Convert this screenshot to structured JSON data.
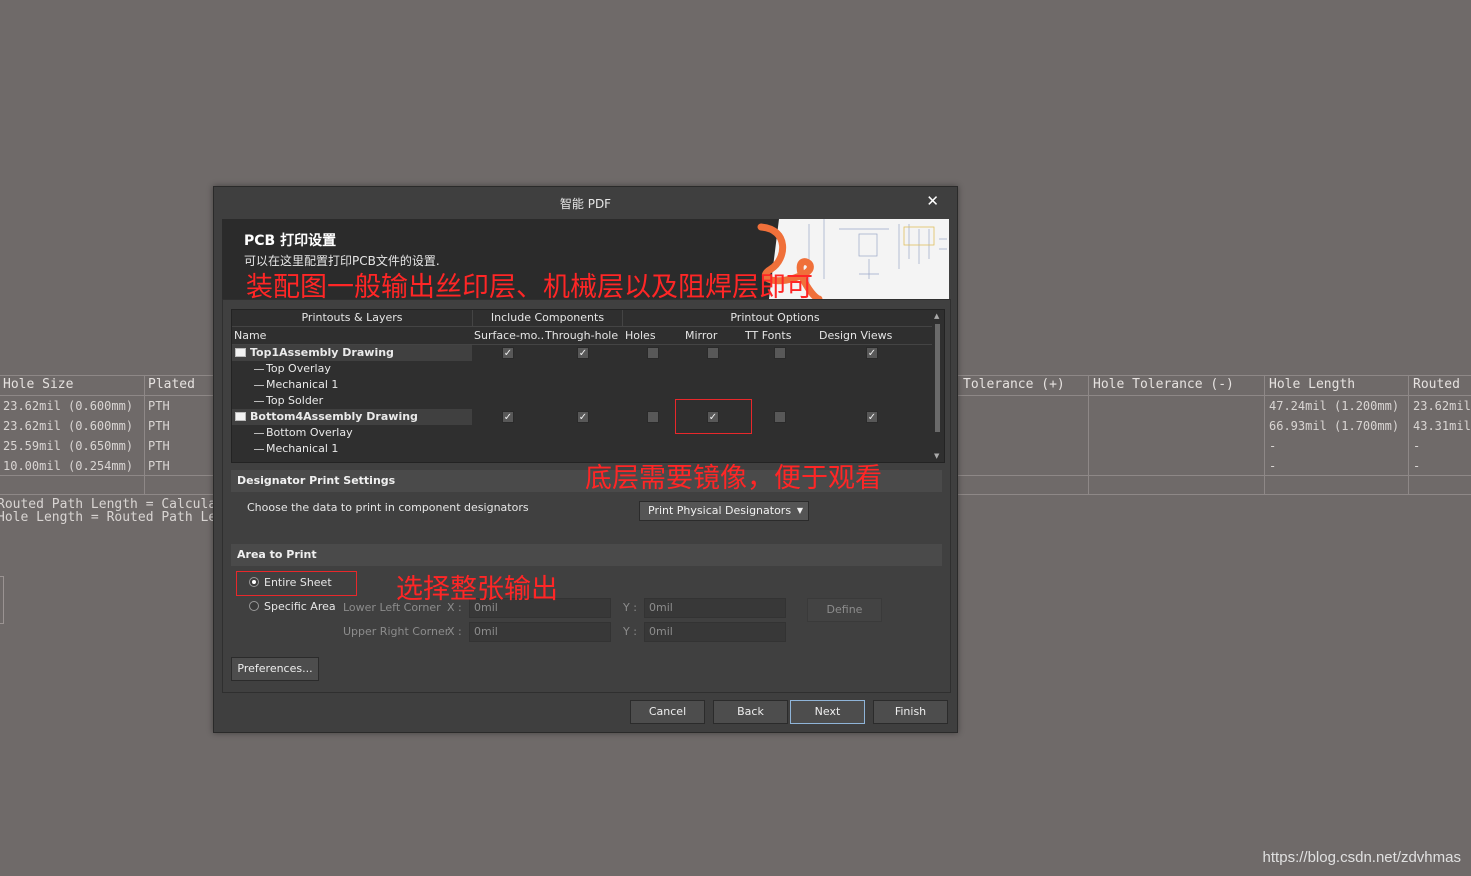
{
  "background_table": {
    "headers": [
      "Hole Size",
      "Plated",
      "Tolerance (+)",
      "Hole Tolerance (-)",
      "Hole Length",
      "Routed"
    ],
    "rows": [
      {
        "hole_size": "23.62mil (0.600mm)",
        "plated": "PTH",
        "hole_length": "47.24mil (1.200mm)",
        "routed": "23.62mil"
      },
      {
        "hole_size": "23.62mil (0.600mm)",
        "plated": "PTH",
        "hole_length": "66.93mil (1.700mm)",
        "routed": "43.31mil"
      },
      {
        "hole_size": "25.59mil (0.650mm)",
        "plated": "PTH",
        "hole_length": "-",
        "routed": "-"
      },
      {
        "hole_size": "10.00mil (0.254mm)",
        "plated": "PTH",
        "hole_length": "-",
        "routed": "-"
      }
    ],
    "notes": [
      "Routed Path Length = Calculat",
      "Hole Length  = Routed Path Le"
    ]
  },
  "watermark": "https://blog.csdn.net/zdvhmas",
  "dialog": {
    "title": "智能 PDF",
    "close_glyph": "✕",
    "banner": {
      "title": "PCB 打印设置",
      "subtitle": "可以在这里配置打印PCB文件的设置."
    },
    "table": {
      "group_headers": {
        "printouts": "Printouts & Layers",
        "include": "Include Components",
        "options": "Printout Options"
      },
      "columns": {
        "name": "Name",
        "surface": "Surface-mo...",
        "through": "Through-hole",
        "holes": "Holes",
        "mirror": "Mirror",
        "ttfonts": "TT Fonts",
        "design": "Design Views"
      },
      "printouts": [
        {
          "name": "Top1Assembly Drawing",
          "surface": true,
          "through": true,
          "holes": false,
          "mirror": false,
          "ttfonts": false,
          "design": true,
          "layers": [
            "Top Overlay",
            "Mechanical 1",
            "Top Solder"
          ]
        },
        {
          "name": "Bottom4Assembly Drawing",
          "surface": true,
          "through": true,
          "holes": false,
          "mirror": true,
          "ttfonts": false,
          "design": true,
          "layers": [
            "Bottom Overlay",
            "Mechanical 1"
          ]
        }
      ]
    },
    "designator": {
      "section": "Designator Print Settings",
      "label": "Choose the data to print in component designators",
      "dropdown": "Print Physical Designators"
    },
    "area": {
      "section": "Area to Print",
      "entire_sheet": "Entire Sheet",
      "specific_area": "Specific Area",
      "selected": "entire_sheet",
      "lower_left": "Lower Left Corner",
      "upper_right": "Upper Right Corner",
      "x_label": "X :",
      "y_label": "Y :",
      "ll_x": "0mil",
      "ll_y": "0mil",
      "ur_x": "0mil",
      "ur_y": "0mil",
      "define": "Define"
    },
    "preferences": "Preferences...",
    "buttons": {
      "cancel": "Cancel",
      "back": "Back",
      "next": "Next",
      "finish": "Finish"
    }
  },
  "annotations": {
    "assembly": "装配图一般输出丝印层、机械层以及阻焊层即可",
    "mirror": "底层需要镜像，便于观看",
    "entire": "选择整张输出"
  },
  "colors": {
    "annotation": "#ff2626",
    "accent": "#f0703a",
    "dialog_bg": "#3f3f3f"
  }
}
